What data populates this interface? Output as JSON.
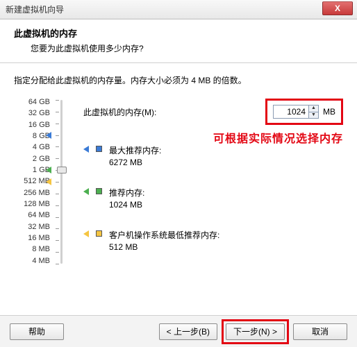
{
  "window": {
    "title": "新建虚拟机向导",
    "close": "X"
  },
  "header": {
    "title": "此虚拟机的内存",
    "subtitle": "您要为此虚拟机使用多少内存?"
  },
  "instruction": "指定分配给此虚拟机的内存量。内存大小必须为 4 MB 的倍数。",
  "memory": {
    "label": "此虚拟机的内存(M):",
    "value": "1024",
    "unit": "MB"
  },
  "annotation": "可根据实际情况选择内存",
  "scale": [
    "64 GB",
    "32 GB",
    "16 GB",
    "8 GB",
    "4 GB",
    "2 GB",
    "1 GB",
    "512 MB",
    "256 MB",
    "128 MB",
    "64 MB",
    "32 MB",
    "16 MB",
    "8 MB",
    "4 MB"
  ],
  "recs": {
    "max": {
      "label": "最大推荐内存:",
      "value": "6272 MB",
      "color": "#3b7bd6",
      "box": "#3b7bd6"
    },
    "rec": {
      "label": "推荐内存:",
      "value": "1024 MB",
      "color": "#4caf50",
      "box": "#4caf50"
    },
    "min": {
      "label": "客户机操作系统最低推荐内存:",
      "value": "512 MB",
      "color": "#f5c542",
      "box": "#f5c542"
    }
  },
  "buttons": {
    "help": "帮助",
    "back": "< 上一步(B)",
    "next": "下一步(N) >",
    "cancel": "取消"
  }
}
